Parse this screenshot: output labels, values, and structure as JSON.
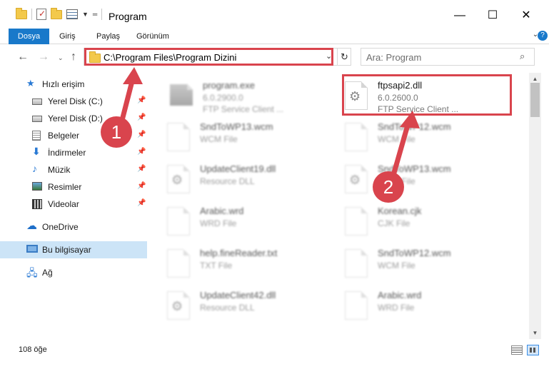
{
  "window": {
    "title": "Program",
    "minimize_glyph": "—",
    "maximize_glyph": "☐",
    "close_glyph": "✕"
  },
  "ribbon": {
    "tabs": [
      "Dosya",
      "Giriş",
      "Paylaş",
      "Görünüm"
    ],
    "accent_color": "#1979ca"
  },
  "address": {
    "path": "C:\\Program Files\\Program Dizini"
  },
  "search": {
    "placeholder": "Ara: Program"
  },
  "sidebar": {
    "quick_access": "Hızlı erişim",
    "items": [
      {
        "label": "Yerel Disk (C:)",
        "icon": "drive-icon",
        "pinned": true
      },
      {
        "label": "Yerel Disk (D:)",
        "icon": "drive-icon",
        "pinned": true
      },
      {
        "label": "Belgeler",
        "icon": "documents-icon",
        "pinned": true
      },
      {
        "label": "İndirmeler",
        "icon": "downloads-icon",
        "pinned": true
      },
      {
        "label": "Müzik",
        "icon": "music-icon",
        "pinned": true
      },
      {
        "label": "Resimler",
        "icon": "pictures-icon",
        "pinned": true
      },
      {
        "label": "Videolar",
        "icon": "videos-icon",
        "pinned": true
      }
    ],
    "onedrive": "OneDrive",
    "this_pc": "Bu bilgisayar",
    "network": "Ağ"
  },
  "files": [
    {
      "name": "program.exe",
      "line1": "6.0.2900.0",
      "line2": "FTP Service Client ...",
      "faded": true
    },
    {
      "name": "ftpsapi2.dll",
      "line1": "6.0.2600.0",
      "line2": "FTP Service Client ...",
      "faded": false
    },
    {
      "name": "SndToWP13.wcm",
      "line1": "WCM File",
      "faded": true
    },
    {
      "name": "SndToWP12.wcm",
      "line1": "WCM File",
      "faded": true
    },
    {
      "name": "UpdateClient19.dll",
      "line1": "Resource DLL",
      "faded": true
    },
    {
      "name": "SndToWP13.wcm",
      "line1": "WCM File",
      "faded": true
    },
    {
      "name": "Arabic.wrd",
      "line1": "WRD File",
      "faded": true
    },
    {
      "name": "Korean.cjk",
      "line1": "CJK File",
      "faded": true
    },
    {
      "name": "help.fineReader.txt",
      "line1": "TXT File",
      "faded": true
    },
    {
      "name": "SndToWP12.wcm",
      "line1": "WCM File",
      "faded": true
    },
    {
      "name": "UpdateClient42.dll",
      "line1": "Resource DLL",
      "faded": true
    },
    {
      "name": "Arabic.wrd",
      "line1": "WRD File",
      "faded": true
    }
  ],
  "status": {
    "item_count": "108 öğe"
  },
  "callouts": {
    "step1": "1",
    "step2": "2",
    "color": "#d9444d"
  }
}
